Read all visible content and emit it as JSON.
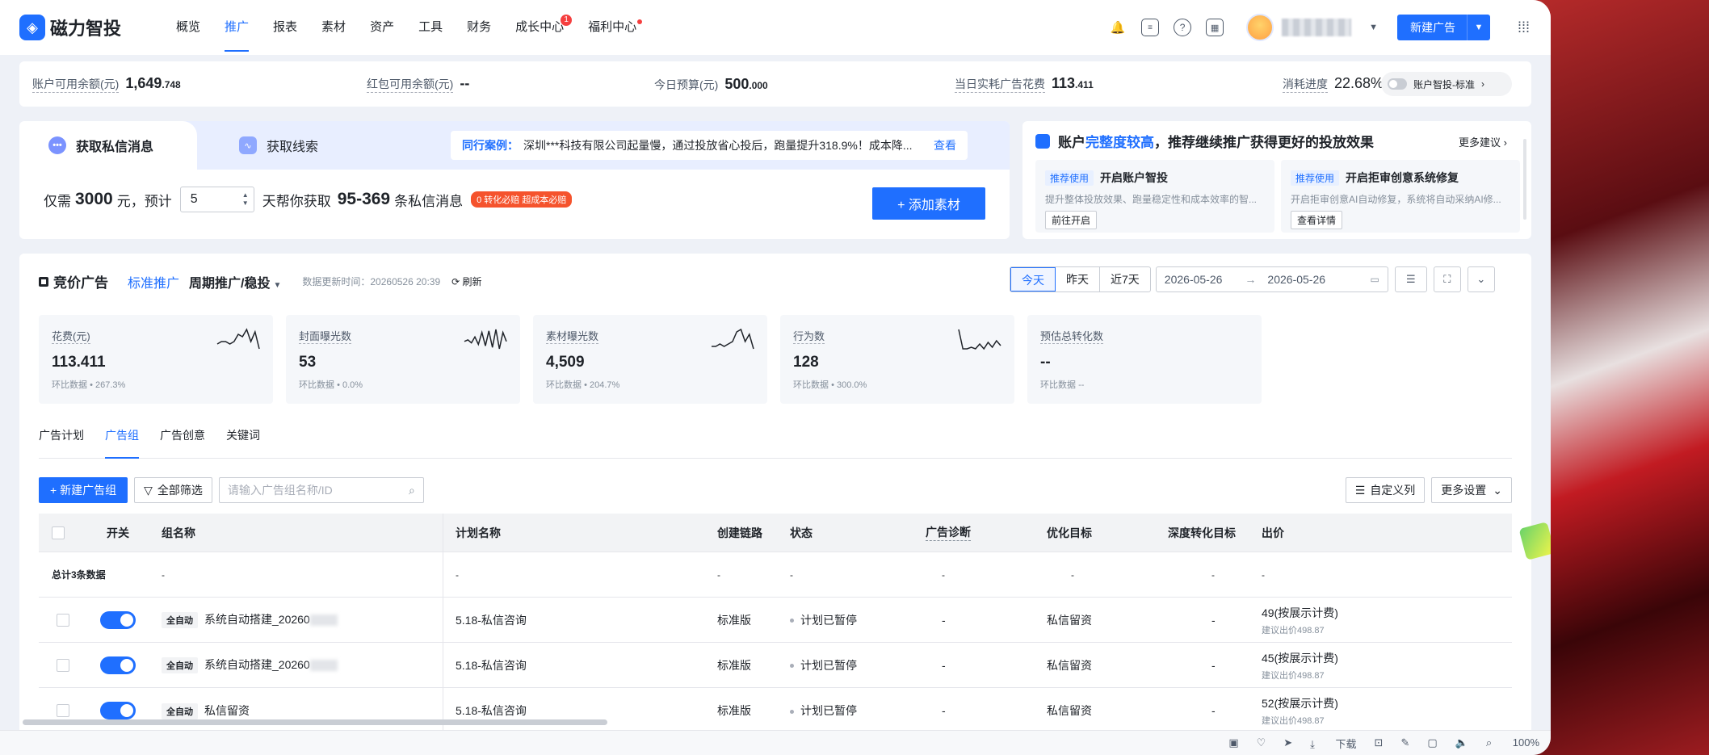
{
  "nav": {
    "brand": "磁力智投",
    "menu": [
      {
        "label": "概览"
      },
      {
        "label": "推广"
      },
      {
        "label": "报表"
      },
      {
        "label": "素材"
      },
      {
        "label": "资产"
      },
      {
        "label": "工具"
      },
      {
        "label": "财务"
      },
      {
        "label": "成长中心",
        "badge": "1"
      },
      {
        "label": "福利中心"
      }
    ],
    "active_menu": "推广",
    "new_ad_label": "新建广告"
  },
  "stats": {
    "balance_label": "账户可用余额(元)",
    "balance_int": "1,649",
    "balance_dec": ".748",
    "redpack_label": "红包可用余额(元)",
    "redpack_value": "--",
    "budget_label": "今日预算(元)",
    "budget_int": "500",
    "budget_dec": ".000",
    "spend_label": "当日实耗广告花费",
    "spend_int": "113",
    "spend_dec": ".411",
    "progress_label": "消耗进度",
    "progress_value": "22.68%",
    "smart_label": "账户智投-标准"
  },
  "promo": {
    "tab1": "获取私信消息",
    "tab2": "获取线索",
    "case_title": "同行案例：",
    "case_text": "深圳***科技有限公司起量慢，通过投放省心投后，跑量提升318.9%！成本降...",
    "case_more": "查看",
    "text_only": "仅需",
    "amount": "3000",
    "text_yuan": "元，预计",
    "days": "5",
    "text_help": "天帮你获取",
    "range": "95-369",
    "text_msgs": "条私信消息",
    "tag": "0 转化必赔 超成本必赔",
    "add_button": "+ 添加素材"
  },
  "suggest": {
    "title_pre": "账户",
    "title_hl": "完整度较高",
    "title_post": "，推荐继续推广获得更好的投放效果",
    "more": "更多建议",
    "cards": [
      {
        "tag": "推荐使用",
        "title": "开启账户智投",
        "desc": "提升整体投放效果、跑量稳定性和成本效率的智...",
        "button": "前往开启"
      },
      {
        "tag": "推荐使用",
        "title": "开启拒审创意系统修复",
        "desc": "开启拒审创意AI自动修复，系统将自动采纳AI修...",
        "button": "查看详情"
      }
    ]
  },
  "main": {
    "title": "竞价广告",
    "mode": "标准推广",
    "sub_mode": "周期推广/稳投",
    "update_time": "数据更新时间：20260526 20:39",
    "refresh": "刷新",
    "date_tabs": [
      "今天",
      "昨天",
      "近7天"
    ],
    "date_start": "2026-05-26",
    "date_end": "2026-05-26"
  },
  "kpis": [
    {
      "label": "花费(元)",
      "value": "113.411",
      "cmp_label": "环比数据",
      "cmp": "• 267.3%",
      "trend": [
        10,
        11,
        11,
        10,
        11,
        14,
        13,
        16,
        11,
        15,
        8
      ]
    },
    {
      "label": "封面曝光数",
      "value": "53",
      "cmp_label": "环比数据",
      "cmp": "• 0.0%",
      "trend": [
        12,
        13,
        11,
        15,
        10,
        18,
        9,
        19,
        8,
        20,
        7,
        18,
        12
      ]
    },
    {
      "label": "素材曝光数",
      "value": "4,509",
      "cmp_label": "环比数据",
      "cmp": "• 204.7%",
      "trend": [
        10,
        10,
        11,
        10,
        11,
        12,
        16,
        17,
        12,
        15,
        9
      ]
    },
    {
      "label": "行为数",
      "value": "128",
      "cmp_label": "环比数据",
      "cmp": "• 300.0%",
      "trend": [
        20,
        8,
        8,
        9,
        8,
        11,
        8,
        12,
        9,
        13,
        10
      ]
    },
    {
      "label": "预估总转化数",
      "value": "--",
      "cmp_label": "环比数据",
      "cmp": "--",
      "trend": []
    }
  ],
  "subtabs": [
    "广告计划",
    "广告组",
    "广告创意",
    "关键词"
  ],
  "active_subtab": "广告组",
  "toolbar": {
    "new_group": "+ 新建广告组",
    "filter": "全部筛选",
    "search_placeholder": "请输入广告组名称/ID",
    "custom_cols": "自定义列",
    "more_settings": "更多设置"
  },
  "table": {
    "headers": {
      "switch": "开关",
      "group_name": "组名称",
      "plan_name": "计划名称",
      "chain": "创建链路",
      "status": "状态",
      "diag": "广告诊断",
      "goal": "优化目标",
      "deep_goal": "深度转化目标",
      "bid": "出价"
    },
    "summary": {
      "label": "总计3条数据",
      "c1": "-",
      "c2": "-",
      "c3": "-",
      "c4": "-",
      "c5": "-",
      "c6": "-",
      "c7": "-",
      "c8": "-"
    },
    "rows": [
      {
        "tag": "全自动",
        "name": "系统自动搭建_20260",
        "plan": "5.18-私信咨询",
        "chain": "标准版",
        "status": "计划已暂停",
        "diag": "-",
        "goal": "私信留资",
        "deep": "-",
        "bid": "49(按展示计费)",
        "bid_suggest": "建议出价498.87"
      },
      {
        "tag": "全自动",
        "name": "系统自动搭建_20260",
        "plan": "5.18-私信咨询",
        "chain": "标准版",
        "status": "计划已暂停",
        "diag": "-",
        "goal": "私信留资",
        "deep": "-",
        "bid": "45(按展示计费)",
        "bid_suggest": "建议出价498.87"
      },
      {
        "tag": "全自动",
        "name": "私信留资",
        "plan": "5.18-私信咨询",
        "chain": "标准版",
        "status": "计划已暂停",
        "diag": "-",
        "goal": "私信留资",
        "deep": "-",
        "bid": "52(按展示计费)",
        "bid_suggest": "建议出价498.87"
      }
    ]
  },
  "bottombar": {
    "download": "下载",
    "zoom": "100%"
  }
}
